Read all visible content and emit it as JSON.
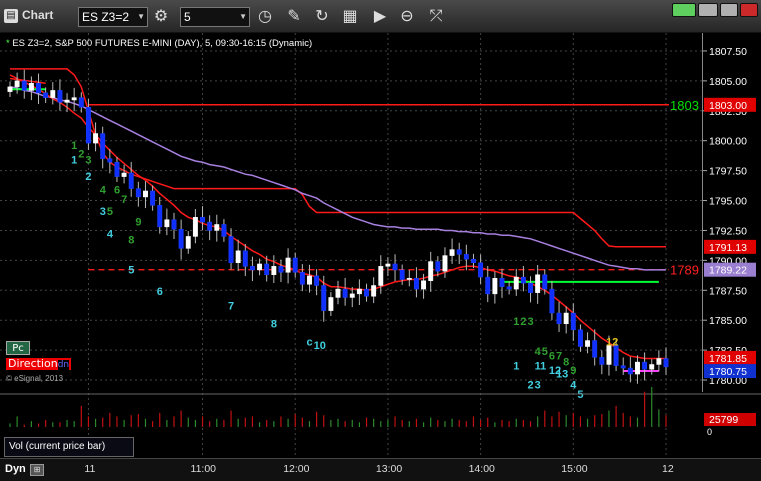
{
  "window": {
    "title": "Chart",
    "symbol_value": "ES Z3=2",
    "interval_value": "5"
  },
  "chart": {
    "title": "ES Z3=2, S&P 500 FUTURES E-MINI (DAY), 5, 09:30-16:15 (Dynamic)",
    "pc_label": "Pc",
    "direction_label": "Direction",
    "direction_tail": "dn",
    "copyright": "© eSignal, 2013",
    "vol_label": "Vol (current price bar)",
    "dyn_label": "Dyn"
  },
  "price_axis": {
    "ticks": [
      "1807.50",
      "1805.00",
      "1802.50",
      "1800.00",
      "1797.50",
      "1795.00",
      "1792.50",
      "1790.00",
      "1787.50",
      "1785.00",
      "1782.50",
      "1780.00"
    ],
    "tags": [
      {
        "label": "1803.00",
        "value": 1803.0,
        "color": "#e00000"
      },
      {
        "label": "1791.13",
        "value": 1791.13,
        "color": "#e00000"
      },
      {
        "label": "1789.22",
        "value": 1789.22,
        "color": "#9a7fd0"
      },
      {
        "label": "1781.85",
        "value": 1781.85,
        "color": "#e00000"
      },
      {
        "label": "1780.75",
        "value": 1780.75,
        "color": "#1030d0"
      }
    ],
    "level_labels": [
      {
        "label": "1803",
        "value": 1803.0,
        "color": "#00e000"
      },
      {
        "label": "1789",
        "value": 1789.22,
        "color": "#ff2020"
      }
    ],
    "volume_tag": "25799",
    "volume_zero": "0"
  },
  "time_axis": {
    "labels": [
      "11",
      "11:00",
      "12:00",
      "13:00",
      "14:00",
      "15:00",
      "12"
    ]
  },
  "colors": {
    "up_candle": "#ffffff",
    "down_candle": "#1030ff",
    "ema_red": "#ff1a1a",
    "vwap": "#a880e0",
    "green_line": "#00ff33",
    "pink": "#ff40ff",
    "vol_up": "#2c8a2c",
    "vol_down": "#c01010",
    "grid": "#444444"
  },
  "chart_data": {
    "type": "candlestick",
    "symbol": "ES Z3=2",
    "interval_minutes": 5,
    "ylim": [
      1779.0,
      1809.0
    ],
    "closes": [
      1804.5,
      1805.0,
      1804.2,
      1804.8,
      1804.0,
      1803.6,
      1804.2,
      1803.2,
      1803.4,
      1803.6,
      1802.8,
      1799.8,
      1800.6,
      1798.5,
      1798.2,
      1797.0,
      1797.3,
      1796.0,
      1795.3,
      1795.8,
      1794.6,
      1792.8,
      1793.4,
      1792.6,
      1791.0,
      1792.0,
      1793.6,
      1793.2,
      1792.5,
      1793.0,
      1792.0,
      1789.8,
      1790.8,
      1789.5,
      1789.2,
      1789.7,
      1788.8,
      1789.5,
      1789.0,
      1790.2,
      1789.0,
      1788.0,
      1788.7,
      1787.9,
      1785.8,
      1786.9,
      1787.6,
      1786.9,
      1787.2,
      1787.6,
      1787.0,
      1787.9,
      1789.5,
      1789.7,
      1789.2,
      1788.4,
      1788.5,
      1787.6,
      1788.3,
      1789.9,
      1789.1,
      1790.4,
      1790.9,
      1790.5,
      1790.1,
      1789.8,
      1788.6,
      1787.2,
      1788.5,
      1787.8,
      1787.6,
      1788.6,
      1788.1,
      1787.3,
      1788.8,
      1787.6,
      1785.6,
      1784.7,
      1785.6,
      1784.2,
      1782.8,
      1783.3,
      1781.9,
      1781.3,
      1782.9,
      1781.2,
      1781.0,
      1780.5,
      1781.5,
      1780.9,
      1781.3,
      1781.8,
      1781.1
    ],
    "counts": [
      {
        "label": "1",
        "index": 9,
        "price": 1799.3,
        "color": "#30a030"
      },
      {
        "label": "2",
        "index": 10,
        "price": 1798.6,
        "color": "#30a030"
      },
      {
        "label": "3",
        "index": 11,
        "price": 1798.1,
        "color": "#30a030"
      },
      {
        "label": "1",
        "index": 9,
        "price": 1798.1,
        "color": "#40d0e0"
      },
      {
        "label": "2",
        "index": 11,
        "price": 1796.7,
        "color": "#40d0e0"
      },
      {
        "label": "4",
        "index": 13,
        "price": 1795.6,
        "color": "#30a030"
      },
      {
        "label": "6",
        "index": 15,
        "price": 1795.6,
        "color": "#30a030"
      },
      {
        "label": "7",
        "index": 16,
        "price": 1794.8,
        "color": "#30a030"
      },
      {
        "label": "3",
        "index": 13,
        "price": 1793.8,
        "color": "#40d0e0"
      },
      {
        "label": "5",
        "index": 14,
        "price": 1793.8,
        "color": "#30a030"
      },
      {
        "label": "9",
        "index": 18,
        "price": 1792.9,
        "color": "#30a030"
      },
      {
        "label": "4",
        "index": 14,
        "price": 1791.9,
        "color": "#40d0e0"
      },
      {
        "label": "8",
        "index": 17,
        "price": 1791.4,
        "color": "#30a030"
      },
      {
        "label": "5",
        "index": 17,
        "price": 1788.9,
        "color": "#40d0e0"
      },
      {
        "label": "6",
        "index": 21,
        "price": 1787.1,
        "color": "#40d0e0"
      },
      {
        "label": "7",
        "index": 31,
        "price": 1785.9,
        "color": "#40d0e0"
      },
      {
        "label": "8",
        "index": 37,
        "price": 1784.4,
        "color": "#40d0e0"
      },
      {
        "label": "c",
        "index": 42,
        "price": 1782.9,
        "color": "#40d0e0"
      },
      {
        "label": "10",
        "index": 43,
        "price": 1782.6,
        "color": "#40d0e0"
      },
      {
        "label": "1",
        "index": 71,
        "price": 1784.6,
        "color": "#30a030"
      },
      {
        "label": "2",
        "index": 72,
        "price": 1784.6,
        "color": "#30a030"
      },
      {
        "label": "3",
        "index": 73,
        "price": 1784.6,
        "color": "#30a030"
      },
      {
        "label": "12",
        "index": 84,
        "price": 1782.9,
        "color": "#e0c020"
      },
      {
        "label": "4",
        "index": 74,
        "price": 1782.1,
        "color": "#30a030"
      },
      {
        "label": "5",
        "index": 75,
        "price": 1782.1,
        "color": "#30a030"
      },
      {
        "label": "6",
        "index": 76,
        "price": 1781.7,
        "color": "#30a030"
      },
      {
        "label": "7",
        "index": 77,
        "price": 1781.7,
        "color": "#30a030"
      },
      {
        "label": "8",
        "index": 78,
        "price": 1781.2,
        "color": "#30a030"
      },
      {
        "label": "1",
        "index": 71,
        "price": 1780.9,
        "color": "#40d0e0"
      },
      {
        "label": "11",
        "index": 74,
        "price": 1780.9,
        "color": "#40d0e0"
      },
      {
        "label": "12",
        "index": 76,
        "price": 1780.5,
        "color": "#40d0e0"
      },
      {
        "label": "13",
        "index": 77,
        "price": 1780.2,
        "color": "#40d0e0"
      },
      {
        "label": "9",
        "index": 79,
        "price": 1780.5,
        "color": "#30a030"
      },
      {
        "label": "2",
        "index": 73,
        "price": 1779.3,
        "color": "#40d0e0"
      },
      {
        "label": "3",
        "index": 74,
        "price": 1779.3,
        "color": "#40d0e0"
      },
      {
        "label": "4",
        "index": 79,
        "price": 1779.3,
        "color": "#40d0e0"
      },
      {
        "label": "5",
        "index": 80,
        "price": 1778.5,
        "color": "#40d0e0"
      }
    ],
    "volume": [
      3,
      9,
      2,
      5,
      3,
      6,
      4,
      4,
      6,
      5,
      18,
      9,
      7,
      8,
      12,
      9,
      6,
      10,
      11,
      7,
      5,
      12,
      6,
      9,
      14,
      8,
      6,
      9,
      5,
      7,
      6,
      14,
      7,
      8,
      9,
      4,
      6,
      5,
      9,
      7,
      11,
      8,
      5,
      13,
      10,
      6,
      7,
      5,
      6,
      4,
      8,
      7,
      5,
      6,
      9,
      6,
      5,
      7,
      4,
      8,
      6,
      5,
      7,
      6,
      5,
      9,
      6,
      8,
      4,
      6,
      5,
      7,
      6,
      5,
      9,
      14,
      9,
      13,
      10,
      12,
      9,
      7,
      10,
      11,
      14,
      18,
      12,
      9,
      8,
      30,
      34,
      15,
      10
    ],
    "ema_red": [
      1805.5,
      1805.2,
      1804.9,
      1804.6,
      1804.3,
      1803.9,
      1803.5,
      1803.2,
      1802.8,
      1802.3,
      1801.9,
      1801.1,
      1800.5,
      1799.8,
      1799.2,
      1798.6,
      1798.1,
      1797.6,
      1797.1,
      1796.7,
      1796.2,
      1795.6,
      1795.1,
      1794.6,
      1794.0,
      1793.6,
      1793.4,
      1793.1,
      1792.9,
      1792.8,
      1792.5,
      1792.0,
      1791.6,
      1791.2,
      1790.8,
      1790.5,
      1790.1,
      1789.9,
      1789.6,
      1789.4,
      1789.2,
      1788.9,
      1788.8,
      1788.6,
      1788.1,
      1787.8,
      1787.8,
      1787.7,
      1787.6,
      1787.6,
      1787.5,
      1787.6,
      1787.8,
      1788.0,
      1788.2,
      1788.3,
      1788.4,
      1788.4,
      1788.5,
      1788.7,
      1788.8,
      1789.0,
      1789.2,
      1789.4,
      1789.5,
      1789.5,
      1789.4,
      1789.2,
      1789.1,
      1788.9,
      1788.7,
      1788.6,
      1788.4,
      1788.1,
      1787.8,
      1787.5,
      1787.1,
      1786.6,
      1786.1,
      1785.6,
      1785.0,
      1784.5,
      1784.0,
      1783.5,
      1783.1,
      1782.7,
      1782.3,
      1782.0,
      1781.9,
      1781.8,
      1781.8,
      1781.8,
      1781.8
    ],
    "vwap": [
      1804.5,
      1804.4,
      1804.2,
      1804.1,
      1803.9,
      1803.7,
      1803.6,
      1803.4,
      1803.3,
      1803.1,
      1802.9,
      1802.6,
      1802.3,
      1802.0,
      1801.7,
      1801.4,
      1801.1,
      1800.8,
      1800.5,
      1800.2,
      1799.9,
      1799.6,
      1799.3,
      1799.0,
      1798.7,
      1798.5,
      1798.3,
      1798.2,
      1798.0,
      1797.9,
      1797.8,
      1797.6,
      1797.4,
      1797.2,
      1797.1,
      1796.9,
      1796.7,
      1796.5,
      1796.3,
      1796.1,
      1795.9,
      1795.6,
      1795.4,
      1795.2,
      1794.8,
      1794.5,
      1794.2,
      1793.9,
      1793.6,
      1793.4,
      1793.2,
      1793.0,
      1792.9,
      1792.8,
      1792.8,
      1792.7,
      1792.7,
      1792.6,
      1792.6,
      1792.6,
      1792.6,
      1792.5,
      1792.5,
      1792.4,
      1792.4,
      1792.3,
      1792.3,
      1792.2,
      1792.2,
      1792.1,
      1792.1,
      1792.0,
      1791.9,
      1791.8,
      1791.6,
      1791.4,
      1791.2,
      1791.0,
      1790.8,
      1790.6,
      1790.4,
      1790.2,
      1790.0,
      1789.8,
      1789.6,
      1789.5,
      1789.4,
      1789.3,
      1789.3,
      1789.2,
      1789.2,
      1789.2,
      1789.2
    ],
    "upper_band_red": [
      1806.0,
      1806.0,
      1806.0,
      1806.0,
      1806.0,
      1806.0,
      1806.0,
      1806.0,
      1806.0,
      1805.5,
      1804.5,
      1802.5,
      1800.5,
      1799.0,
      1798.2,
      1797.8,
      1797.5,
      1797.2,
      1797.0,
      1796.8,
      1796.6,
      1796.4,
      1796.2,
      1796.0,
      1796.0,
      1796.0,
      1796.0,
      1796.0,
      1796.0,
      1796.0,
      1796.0,
      1796.0,
      1796.0,
      1796.0,
      1796.0,
      1796.0,
      1796.0,
      1796.0,
      1796.0,
      1796.0,
      1796.0,
      1795.5,
      1794.5,
      1794.0,
      1794.0,
      1794.0,
      1794.0,
      1794.0,
      1794.0,
      1794.0,
      1794.0,
      1794.0,
      1794.0,
      1794.0,
      1794.0,
      1794.0,
      1794.0,
      1794.0,
      1794.0,
      1794.0,
      1794.0,
      1794.0,
      1794.0,
      1794.0,
      1794.0,
      1794.0,
      1794.0,
      1794.0,
      1794.0,
      1794.0,
      1794.0,
      1794.0,
      1794.0,
      1794.0,
      1794.0,
      1794.0,
      1794.0,
      1794.0,
      1794.0,
      1794.0,
      1793.5,
      1793.0,
      1792.5,
      1791.8,
      1791.2,
      1791.13,
      1791.13,
      1791.13,
      1791.13,
      1791.13,
      1791.13,
      1791.13,
      1791.13
    ],
    "green_line": {
      "from": 69,
      "to": 91,
      "value": 1788.2
    },
    "resistance": {
      "value": 1803.0,
      "from": 11
    },
    "support_dashed": {
      "value": 1789.22,
      "from": 11
    },
    "x_session_start_index": 11,
    "x_tick_indices": [
      11,
      27,
      40,
      53,
      66,
      79,
      92
    ]
  }
}
